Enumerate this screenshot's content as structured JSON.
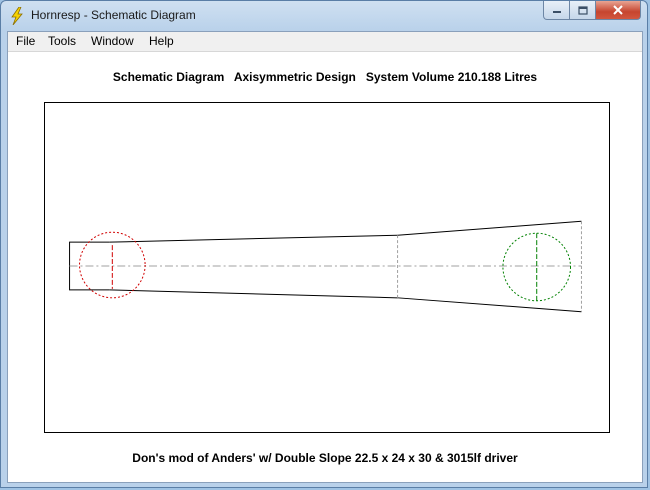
{
  "window": {
    "title": "Hornresp - Schematic Diagram"
  },
  "menu": {
    "items": [
      "File",
      "Tools",
      "Window",
      "Help"
    ]
  },
  "heading": "Schematic Diagram   Axisymmetric Design   System Volume 210.188 Litres",
  "caption": "Don's mod of Anders' w/ Double Slope 22.5 x 24 x 30 & 3015lf driver",
  "icons": {
    "app": "lightning-icon",
    "minimize": "minimize-icon",
    "maximize": "maximize-icon",
    "close": "close-icon"
  },
  "colors": {
    "driver_circle": "#d00000",
    "mouth_circle": "#008000",
    "outline": "#000000",
    "centerline": "#a0a0a0"
  }
}
